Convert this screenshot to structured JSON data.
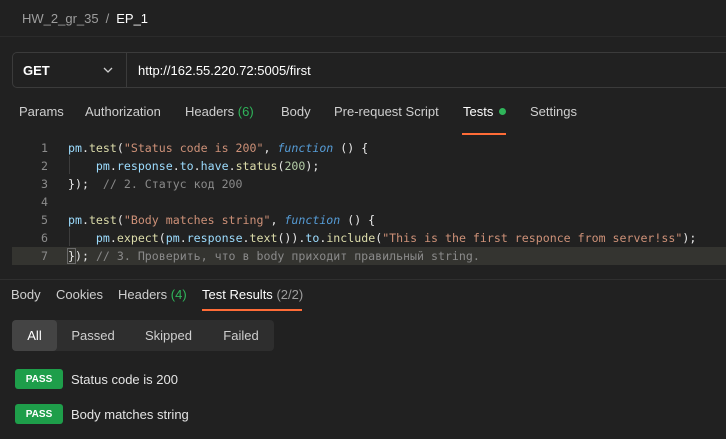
{
  "breadcrumb": {
    "parent": "HW_2_gr_35",
    "separator": "/",
    "current": "EP_1"
  },
  "request": {
    "method": "GET",
    "method_icon": "chevron-down-icon",
    "url": "http://162.55.220.72:5005/first"
  },
  "request_tabs": [
    {
      "label": "Params"
    },
    {
      "label": "Authorization"
    },
    {
      "label": "Headers",
      "count": "(6)"
    },
    {
      "label": "Body"
    },
    {
      "label": "Pre-request Script"
    },
    {
      "label": "Tests",
      "active": true,
      "indicator": "green-dot"
    },
    {
      "label": "Settings"
    }
  ],
  "editor": {
    "line_numbers": [
      "1",
      "2",
      "3",
      "4",
      "5",
      "6",
      "7"
    ],
    "lines": [
      "pm.test(\"Status code is 200\", function () {",
      "    pm.response.to.have.status(200);",
      "});  // 2. Статус код 200",
      "",
      "pm.test(\"Body matches string\", function () {",
      "    pm.expect(pm.response.text()).to.include(\"This is the first responce from server!ss\");",
      "}); // 3. Проверить, что в body приходит правильный string."
    ],
    "highlighted_line": "7"
  },
  "response_tabs": [
    {
      "label": "Body"
    },
    {
      "label": "Cookies"
    },
    {
      "label": "Headers",
      "count": "(4)"
    },
    {
      "label": "Test Results",
      "count": "(2/2)",
      "active": true
    }
  ],
  "filters": [
    {
      "label": "All",
      "active": true
    },
    {
      "label": "Passed"
    },
    {
      "label": "Skipped"
    },
    {
      "label": "Failed"
    }
  ],
  "results": [
    {
      "status": "PASS",
      "name": "Status code is 200"
    },
    {
      "status": "PASS",
      "name": "Body matches string"
    }
  ],
  "colors": {
    "background": "#212121",
    "accent": "#ff6c37",
    "pass": "#1e9e4a",
    "count_green": "#2fb55a"
  }
}
